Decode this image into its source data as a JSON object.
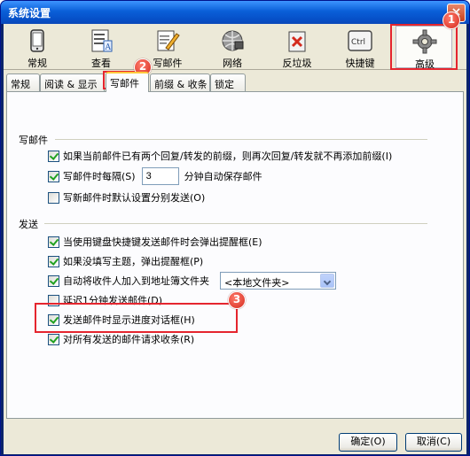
{
  "window": {
    "title": "系统设置",
    "close": "×"
  },
  "toolbar": {
    "items": [
      {
        "label": "常规",
        "icon": "phone-icon"
      },
      {
        "label": "查看",
        "icon": "document-view-icon"
      },
      {
        "label": "写邮件",
        "icon": "compose-icon"
      },
      {
        "label": "网络",
        "icon": "network-icon"
      },
      {
        "label": "反垃圾",
        "icon": "trash-icon"
      },
      {
        "label": "快捷键",
        "icon": "ctrl-key-icon"
      },
      {
        "label": "高级",
        "icon": "gear-icon"
      }
    ],
    "ctrl_text": "Ctrl"
  },
  "tabs": [
    {
      "label": "常规"
    },
    {
      "label": "阅读 & 显示"
    },
    {
      "label": "写邮件"
    },
    {
      "label": "前缀 & 收条"
    },
    {
      "label": "锁定"
    }
  ],
  "compose_group": {
    "title": "写邮件",
    "option1": "如果当前邮件已有两个回复/转发的前缀，则再次回复/转发就不再添加前缀(I)",
    "option2": "写邮件时每隔(S)",
    "option2_value": "3",
    "option2_suffix": "分钟自动保存邮件",
    "option3": "写新邮件时默认设置分别发送(O)"
  },
  "send_group": {
    "title": "发送",
    "option1": "当使用键盘快捷键发送邮件时会弹出提醒框(E)",
    "option2": "如果没填写主题，弹出提醒框(P)",
    "option3": "自动将收件人加入到地址簿文件夹",
    "option3_select": "<本地文件夹>",
    "option4": "延迟1分钟发送邮件(D)",
    "option5": "发送邮件时显示进度对话框(H)",
    "option6": "对所有发送的邮件请求收条(R)"
  },
  "badges": {
    "one": "1",
    "two": "2",
    "three": "3"
  },
  "buttons": {
    "ok": "确定(O)",
    "cancel": "取消(C)"
  },
  "colors": {
    "highlight": "#e5252e",
    "titlebar": "#0a5fd8",
    "check": "#21a121"
  }
}
